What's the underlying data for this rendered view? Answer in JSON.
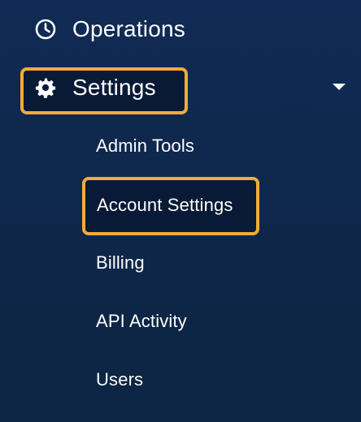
{
  "nav": {
    "operations": {
      "label": "Operations",
      "icon": "clock-icon"
    },
    "settings": {
      "label": "Settings",
      "icon": "gear-icon",
      "expanded_icon": "chevron-down-icon",
      "submenu": [
        {
          "label": "Admin Tools"
        },
        {
          "label": "Account Settings"
        },
        {
          "label": "Billing"
        },
        {
          "label": "API Activity"
        },
        {
          "label": "Users"
        }
      ]
    }
  },
  "colors": {
    "background_top": "#102a55",
    "background_bottom": "#0d2543",
    "text": "#ffffff",
    "highlight_border": "#f2ab3a",
    "highlight_fill": "#081a36"
  }
}
